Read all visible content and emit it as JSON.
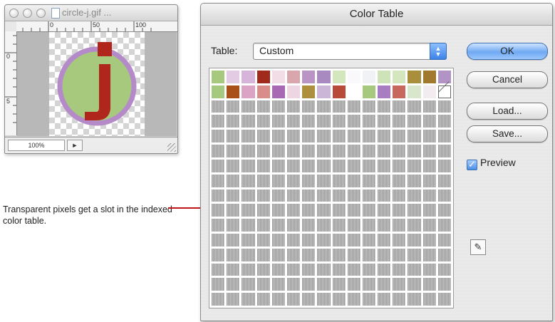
{
  "doc_window": {
    "title": "circle-j.gif ...",
    "zoom": "100%",
    "ruler_marks": [
      "0",
      "50",
      "100"
    ],
    "ruler_left_marks": [
      "0",
      "5"
    ]
  },
  "callout": {
    "text": "Transparent pixels get a slot in the indexed color table."
  },
  "dialog": {
    "title": "Color Table",
    "table_label": "Table:",
    "table_value": "Custom",
    "buttons": {
      "ok": "OK",
      "cancel": "Cancel",
      "load": "Load...",
      "save": "Save..."
    },
    "preview_label": "Preview",
    "preview_checked": true
  },
  "color_table": {
    "columns": 16,
    "rows": 16,
    "used_colors": [
      "#a6c97e",
      "#e2cbe3",
      "#d7b5db",
      "#a02a1c",
      "#f2dde6",
      "#d9a6ad",
      "#b994c4",
      "#a889c0",
      "#d3e6be",
      "#faf8fb",
      "#f1f2f5",
      "#cfe3b9",
      "#d3e6be",
      "#a98e3c",
      "#a0792e",
      "#b293c6",
      "#a6c97e",
      "#a85018",
      "#dca4c4",
      "#d88d8b",
      "#a868b4",
      "#edd6e2",
      "#ac903e",
      "#ccb6d8",
      "#b84b38",
      "#ffffff",
      "#a6c97e",
      "#a87cc0",
      "#c8685c",
      "#d8e6cc",
      "#f2ecf1",
      "transparent"
    ]
  }
}
